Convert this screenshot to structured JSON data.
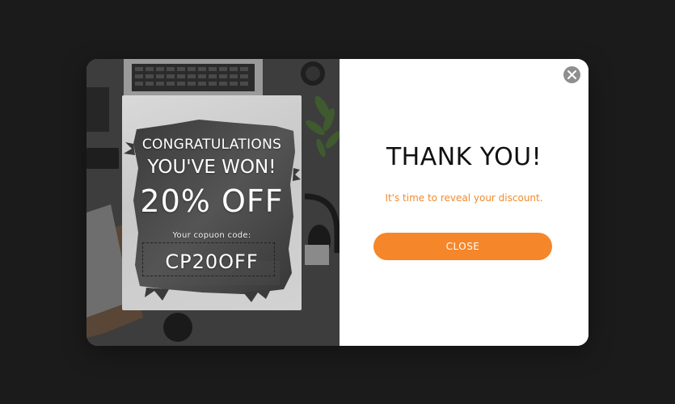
{
  "popup": {
    "scratch_card": {
      "headline": "CONGRATULATIONS",
      "subheadline": "YOU'VE WON!",
      "discount": "20% OFF",
      "code_label": "Your copuon code:",
      "code": "CP20OFF"
    },
    "thank_you": "THANK YOU!",
    "message": "It's time to reveal your discount.",
    "close_button_label": "CLOSE",
    "close_icon": "close-icon"
  },
  "colors": {
    "accent": "#f5862a",
    "message_text": "#f28a2e",
    "backdrop": "#1b1b1b",
    "close_icon_bg": "#8f8f8f"
  }
}
